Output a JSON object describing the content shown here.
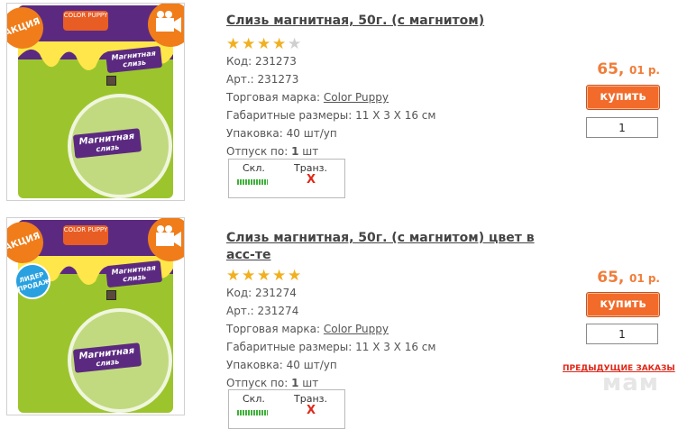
{
  "products": [
    {
      "title": "Слизь магнитная, 50г. (с магнитом)",
      "rating": 4,
      "rating_max": 5,
      "code_label": "Код:",
      "code": "231273",
      "art_label": "Арт.:",
      "art": "231273",
      "brand_label": "Торговая марка:",
      "brand": "Color Puppy",
      "dims_label": "Габаритные размеры:",
      "dims": "11 X 3 X 16 см",
      "pack_label": "Упаковка:",
      "pack": "40 шт/уп",
      "min_label": "Отпуск по:",
      "min_value": "1",
      "min_unit": "шт",
      "stock_header_warehouse": "Скл.",
      "stock_header_transit": "Транз.",
      "transit_mark": "X",
      "price_rub": "65,",
      "price_kop": "01 р.",
      "buy_label": "купить",
      "qty": "1",
      "badges": [
        "АКЦИЯ"
      ]
    },
    {
      "title": "Слизь магнитная, 50г. (с магнитом) цвет в асс-те",
      "rating": 5,
      "rating_max": 5,
      "code_label": "Код:",
      "code": "231274",
      "art_label": "Арт.:",
      "art": "231274",
      "brand_label": "Торговая марка:",
      "brand": "Color Puppy",
      "dims_label": "Габаритные размеры:",
      "dims": "11 X 3 X 16 см",
      "pack_label": "Упаковка:",
      "pack": "40 шт/уп",
      "min_label": "Отпуск по:",
      "min_value": "1",
      "min_unit": "шт",
      "stock_header_warehouse": "Скл.",
      "stock_header_transit": "Транз.",
      "transit_mark": "X",
      "price_rub": "65,",
      "price_kop": "01 р.",
      "buy_label": "купить",
      "qty": "1",
      "badges": [
        "АКЦИЯ",
        "ЛИДЕР ПРОДАЖ"
      ]
    }
  ],
  "package_text": {
    "brand_logo": "COLOR PUPPY",
    "card_label_line1": "Магнитная",
    "card_label_line2": "слизь"
  },
  "previous_orders_label": "ПРЕДЫДУЩИЕ ЗАКАЗЫ",
  "watermark": "мам",
  "colors": {
    "accent_orange": "#f26b2a",
    "price_orange": "#f07d3a",
    "transit_red": "#e0281a",
    "stock_green": "#3fb13a",
    "star_gold": "#f0b020"
  }
}
